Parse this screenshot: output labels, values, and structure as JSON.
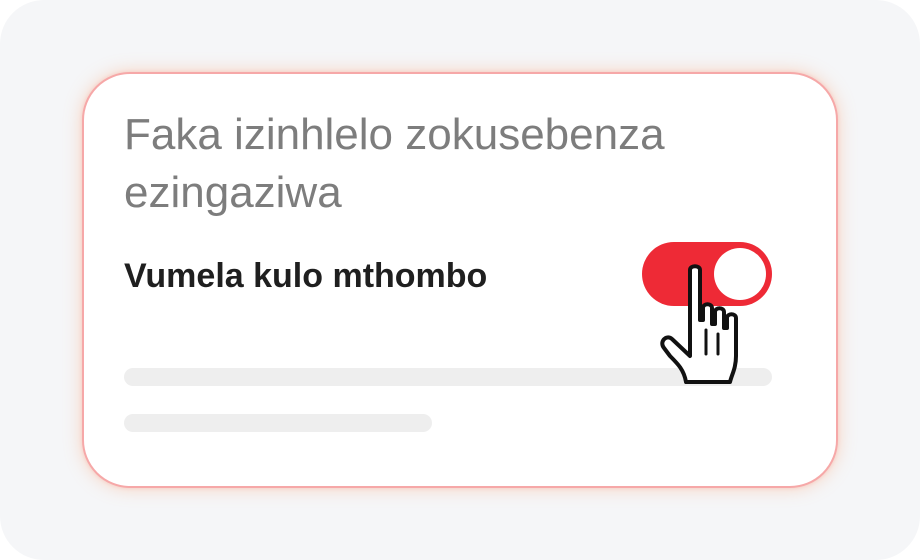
{
  "card": {
    "title": "Faka izinhlelo zokusebenza ezingaziwa",
    "setting_label": "Vumela kulo mthombo",
    "toggle": {
      "state": "on",
      "accent_color": "#ee2a36"
    }
  },
  "cursor": {
    "icon": "pointing-hand-icon"
  },
  "colors": {
    "title_text": "#7d7d7d",
    "label_text": "#1f1f1f",
    "card_border": "#f6a8a8",
    "skeleton": "#eeeeee"
  }
}
